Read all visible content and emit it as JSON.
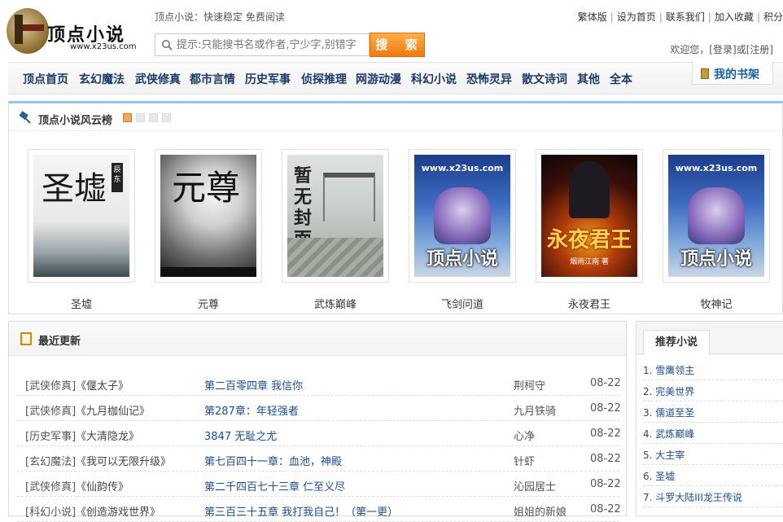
{
  "header": {
    "logo_title": "顶点小说",
    "logo_sub": "www.x23us.com",
    "slogan": "顶点小说：快速稳定 免费阅读",
    "search_placeholder": "提示:只能搜书名或作者,宁少字,别错字",
    "search_button": "搜 索",
    "top_links": [
      "繁体版",
      "设为首页",
      "联系我们",
      "加入收藏",
      "积分"
    ],
    "welcome": "欢迎您，[登录]或[注册]"
  },
  "nav": {
    "items": [
      "顶点首页",
      "玄幻魔法",
      "武侠修真",
      "都市言情",
      "历史军事",
      "侦探推理",
      "网游动漫",
      "科幻小说",
      "恐怖灵异",
      "散文诗词",
      "其他",
      "全本"
    ],
    "bookshelf": "我的书架"
  },
  "ranking": {
    "title": "顶点小说风云榜",
    "books": [
      {
        "name": "圣墟",
        "cover_text": "圣墟",
        "cover_tag": "辰东"
      },
      {
        "name": "元尊",
        "cover_text": "元尊"
      },
      {
        "name": "武炼巅峰",
        "cover_text": "暂无封面"
      },
      {
        "name": "飞剑问道",
        "cover_url": "www.x23us.com",
        "cover_brand": "顶点小说"
      },
      {
        "name": "永夜君王",
        "cover_text": "永夜君王",
        "cover_author": "烟雨江南 著"
      },
      {
        "name": "牧神记",
        "cover_url": "www.x23us.com",
        "cover_brand": "顶点小说"
      }
    ]
  },
  "recent": {
    "title": "最近更新",
    "rows": [
      {
        "cat": "[武侠修真]",
        "book": "《偃太子》",
        "chapter": "第二百零四章 我信你",
        "author": "荆柯守",
        "date": "08-22"
      },
      {
        "cat": "[武侠修真]",
        "book": "《九月枷仙记》",
        "chapter": "第287章：年轻强者",
        "author": "九月铁骑",
        "date": "08-22"
      },
      {
        "cat": "[历史军事]",
        "book": "《大清隐龙》",
        "chapter": "3847 无耻之尤",
        "author": "心净",
        "date": "08-22"
      },
      {
        "cat": "[玄幻魔法]",
        "book": "《我可以无限升级》",
        "chapter": "第七百四十一章：血池，神殿",
        "author": "针虾",
        "date": "08-22"
      },
      {
        "cat": "[武侠修真]",
        "book": "《仙韵传》",
        "chapter": "第二千四百七十三章 仁至义尽",
        "author": "沁园居士",
        "date": "08-22"
      },
      {
        "cat": "[科幻小说]",
        "book": "《创造游戏世界》",
        "chapter": "第三百三十五章 我打我自己！（第一更）",
        "author": "姐姐的新娘",
        "date": "08-22"
      }
    ]
  },
  "recommend": {
    "title": "推荐小说",
    "items": [
      "1. 雪鹰领主",
      "2. 完美世界",
      "3. 儒道至圣",
      "4. 武炼巅峰",
      "5. 大主宰",
      "6. 圣墟",
      "7. 斗罗大陆III龙王传说"
    ]
  },
  "colors": {
    "nav_text": "#1a3a6b",
    "link_blue": "#1a4d8f",
    "search_button": "#ef7b0c",
    "rank_top_border": "#8fc7e8"
  }
}
